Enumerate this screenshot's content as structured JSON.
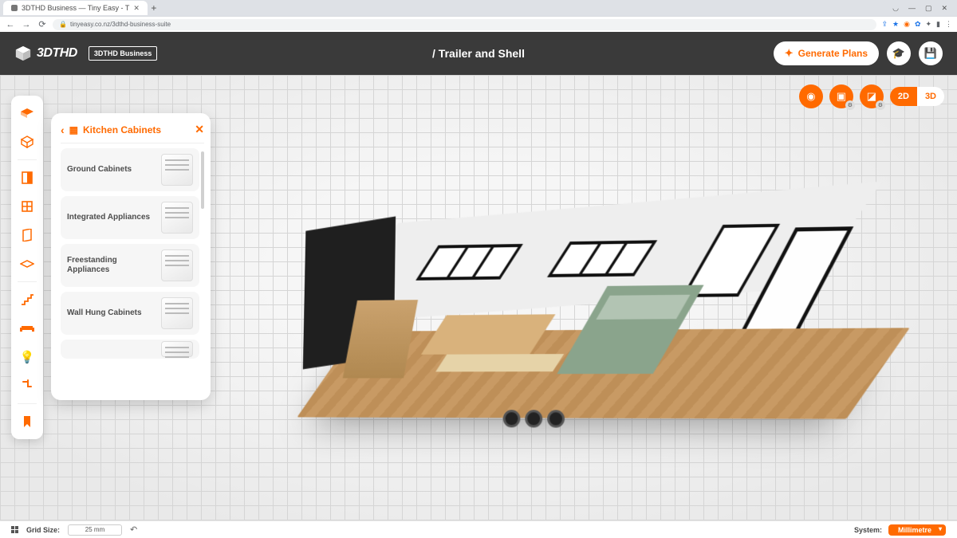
{
  "browser": {
    "tab_title": "3DTHD Business — Tiny Easy - T",
    "url": "tinyeasy.co.nz/3dthd-business-suite"
  },
  "header": {
    "logo_text": "3DTHD",
    "business_badge": "3DTHD Business",
    "breadcrumb": "/ Trailer and Shell",
    "generate_label": "Generate Plans"
  },
  "view": {
    "label_2d": "2D",
    "label_3d": "3D"
  },
  "panel": {
    "title": "Kitchen Cabinets",
    "items": [
      {
        "label": "Ground Cabinets"
      },
      {
        "label": "Integrated Appliances"
      },
      {
        "label": "Freestanding Appliances"
      },
      {
        "label": "Wall Hung Cabinets"
      }
    ]
  },
  "status": {
    "grid_label": "Grid Size:",
    "grid_value": "25 mm",
    "system_label": "System:",
    "system_value": "Millimetre"
  }
}
